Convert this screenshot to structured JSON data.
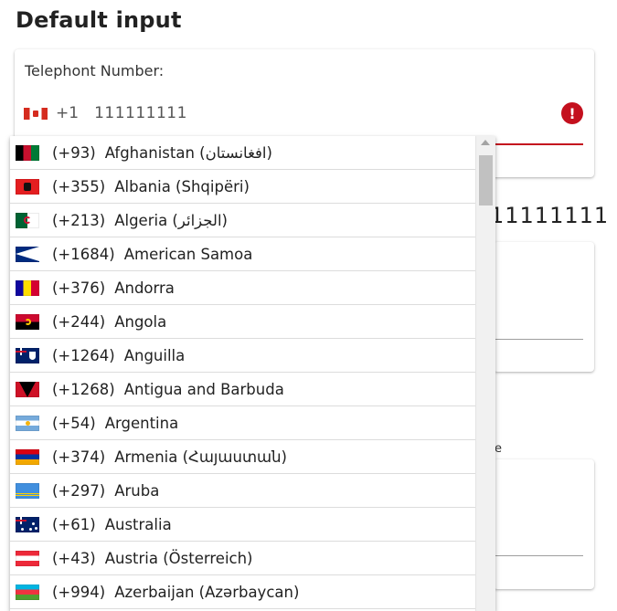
{
  "page": {
    "title": "Default input"
  },
  "phone_field": {
    "label": "Telephont Number:",
    "country": "Canada",
    "flag_icon": "ca-flag-icon",
    "dial_code": "+1",
    "value": "111111111",
    "error_icon": "exclamation-icon",
    "error_color": "#c4101e"
  },
  "background": {
    "number_fragment": "11111111",
    "text_fragment": "e"
  },
  "dropdown": {
    "countries": [
      {
        "code": "(+93)",
        "name": "Afghanistan (افغانستان)"
      },
      {
        "code": "(+355)",
        "name": "Albania (Shqipëri)"
      },
      {
        "code": "(+213)",
        "name": "Algeria (الجزائر)"
      },
      {
        "code": "(+1684)",
        "name": "American Samoa"
      },
      {
        "code": "(+376)",
        "name": "Andorra"
      },
      {
        "code": "(+244)",
        "name": "Angola"
      },
      {
        "code": "(+1264)",
        "name": "Anguilla"
      },
      {
        "code": "(+1268)",
        "name": "Antigua and Barbuda"
      },
      {
        "code": "(+54)",
        "name": "Argentina"
      },
      {
        "code": "(+374)",
        "name": "Armenia (Հայաստան)"
      },
      {
        "code": "(+297)",
        "name": "Aruba"
      },
      {
        "code": "(+61)",
        "name": "Australia"
      },
      {
        "code": "(+43)",
        "name": "Austria (Österreich)"
      },
      {
        "code": "(+994)",
        "name": "Azerbaijan (Azərbaycan)"
      }
    ]
  }
}
